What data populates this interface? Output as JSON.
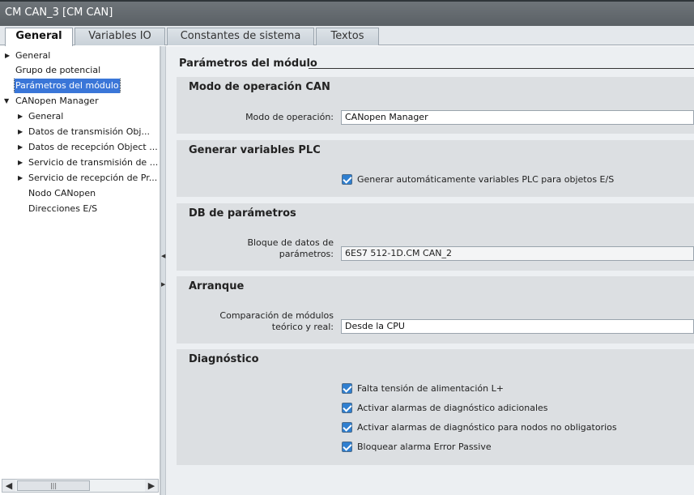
{
  "window": {
    "title": "CM CAN_3 [CM CAN]"
  },
  "tabs": [
    {
      "label": "General"
    },
    {
      "label": "Variables IO"
    },
    {
      "label": "Constantes de sistema"
    },
    {
      "label": "Textos"
    }
  ],
  "tree": [
    {
      "label": "General"
    },
    {
      "label": "Grupo de potencial"
    },
    {
      "label": "Parámetros del módulo"
    },
    {
      "label": "CANopen Manager"
    },
    {
      "label": "General"
    },
    {
      "label": "Datos de transmisión Obj..."
    },
    {
      "label": "Datos de recepción Object ..."
    },
    {
      "label": "Servicio de transmisión de ..."
    },
    {
      "label": "Servicio de recepción de Pr..."
    },
    {
      "label": "Nodo CANopen"
    },
    {
      "label": "Direcciones E/S"
    }
  ],
  "icons": {
    "expand": "▶",
    "collapse": "▼",
    "left": "◀",
    "right": "▶",
    "grip": "|||"
  },
  "page": {
    "heading": "Parámetros del módulo"
  },
  "modo": {
    "title": "Modo de operación CAN",
    "label": "Modo de operación:",
    "value": "CANopen Manager"
  },
  "generar": {
    "title": "Generar variables PLC",
    "checkbox": "Generar automáticamente variables PLC para objetos E/S"
  },
  "db": {
    "title": "DB de parámetros",
    "label_line1": "Bloque de datos de",
    "label_line2": "parámetros:",
    "value": "6ES7 512-1D.CM CAN_2"
  },
  "arranque": {
    "title": "Arranque",
    "label_line1": "Comparación de módulos",
    "label_line2": "teórico y real:",
    "value": "Desde la CPU"
  },
  "diagnostico": {
    "title": "Diagnóstico",
    "items": [
      "Falta tensión de alimentación L+",
      "Activar alarmas de diagnóstico adicionales",
      "Activar alarmas de diagnóstico para nodos no obligatorios",
      "Bloquear alarma Error Passive"
    ]
  },
  "colors": {
    "selection": "#3a76d8",
    "checkbox": "#2f7fd0",
    "section_bg": "#dcdfe2"
  }
}
